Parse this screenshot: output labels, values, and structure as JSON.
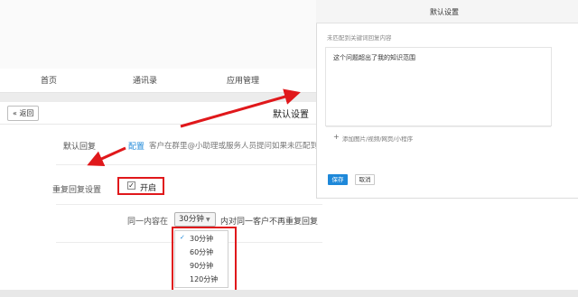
{
  "nav": {
    "items": [
      {
        "label": "首页"
      },
      {
        "label": "通讯录"
      },
      {
        "label": "应用管理"
      }
    ]
  },
  "toolbar": {
    "back_label": "« 返回",
    "page_title": "默认设置"
  },
  "form": {
    "default_reply": {
      "label": "默认回复",
      "link": "配置",
      "description": "客户在群里@小助理或服务人员提问如果未匹配到"
    },
    "repeat_reply": {
      "label": "重复回复设置",
      "checkbox_checked": true,
      "option_label": "开启"
    },
    "same_content": {
      "label": "同一内容在",
      "selected": "30分钟",
      "description": "内对同一客户不再重复回复",
      "options": [
        "30分钟",
        "60分钟",
        "90分钟",
        "120分钟"
      ]
    }
  },
  "dialog": {
    "title": "默认设置",
    "hint": "未匹配到关键词回复内容",
    "content": "这个问题超出了我的知识范围",
    "attach_label": "添加图片/视频/网页/小程序",
    "save_label": "保存",
    "cancel_label": "取消"
  },
  "colors": {
    "accent": "#1e88d9",
    "highlight": "#e0181b"
  }
}
